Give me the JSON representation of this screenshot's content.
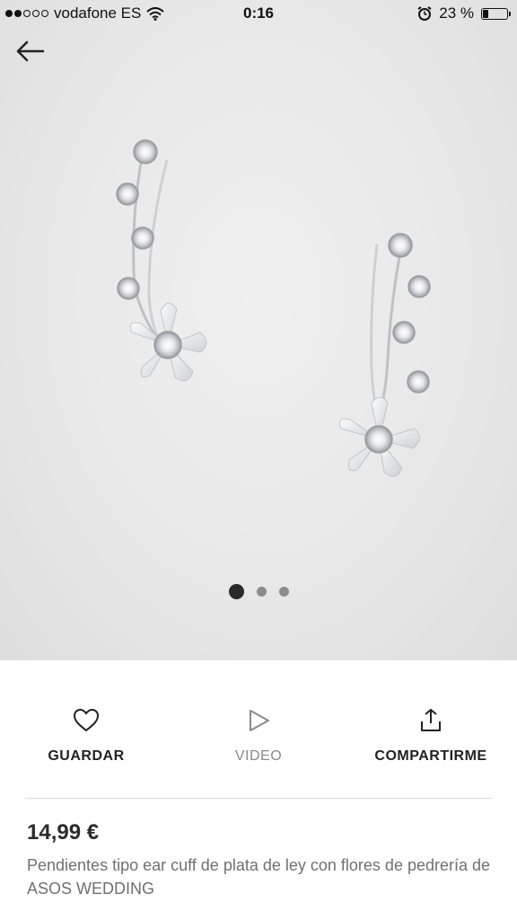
{
  "status_bar": {
    "carrier": "vodafone ES",
    "time": "0:16",
    "battery_text": "23 %",
    "battery_level": 0.23,
    "signal_bars_total": 5,
    "signal_bars_filled": 2,
    "icons": [
      "wifi-icon",
      "alarm-icon",
      "battery-icon"
    ]
  },
  "gallery": {
    "back_icon": "arrow-left-icon",
    "page_count": 3,
    "current_page": 1
  },
  "actions": {
    "save_label": "GUARDAR",
    "save_icon": "heart-icon",
    "video_label": "VIDEO",
    "video_icon": "play-icon",
    "share_label": "COMPARTIRME",
    "share_icon": "share-icon"
  },
  "product": {
    "price": "14,99 €",
    "title": "Pendientes tipo ear cuff de plata de ley con flores de pedrería de ASOS WEDDING"
  },
  "colors": {
    "gallery_bg": "#e8e8e8",
    "text_dark": "#222222",
    "text_muted": "#707070",
    "pager_active": "#2a2a2a",
    "pager_inactive": "#8c8c8c"
  }
}
